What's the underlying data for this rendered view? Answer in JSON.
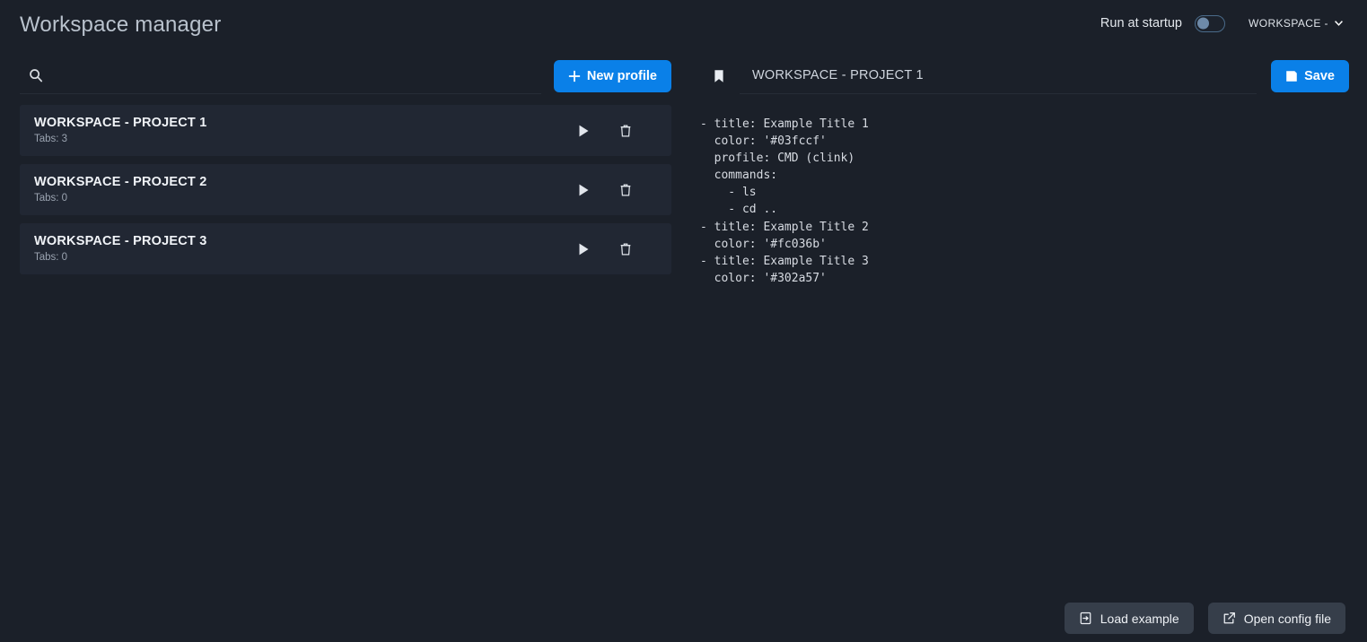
{
  "app": {
    "title": "Workspace manager",
    "accent_color": "#0a80e8",
    "background_color": "#1b2029",
    "row_color": "#212733"
  },
  "header": {
    "run_at_startup_label": "Run at startup",
    "run_at_startup_enabled": false,
    "workspace_select_value": "WORKSPACE - P",
    "workspace_select_icon": "chevron-down-icon"
  },
  "left": {
    "search": {
      "value": "",
      "placeholder": "",
      "icon": "search-icon"
    },
    "new_profile_button": {
      "label": "New profile",
      "icon": "plus-icon"
    },
    "profiles": [
      {
        "title": "WORKSPACE - PROJECT 1",
        "tabs_label": "Tabs: 3",
        "run_icon": "play-icon",
        "delete_icon": "trash-icon"
      },
      {
        "title": "WORKSPACE - PROJECT 2",
        "tabs_label": "Tabs: 0",
        "run_icon": "play-icon",
        "delete_icon": "trash-icon"
      },
      {
        "title": "WORKSPACE - PROJECT 3",
        "tabs_label": "Tabs: 0",
        "run_icon": "play-icon",
        "delete_icon": "trash-icon"
      }
    ]
  },
  "right": {
    "bookmark_icon": "bookmark-icon",
    "profile_name": {
      "value": "WORKSPACE - PROJECT 1",
      "placeholder": ""
    },
    "save_button": {
      "label": "Save",
      "icon": "save-icon"
    },
    "editor": {
      "content": "- title: Example Title 1\n  color: '#03fccf'\n  profile: CMD (clink)\n  commands:\n    - ls\n    - cd ..\n- title: Example Title 2\n  color: '#fc036b'\n- title: Example Title 3\n  color: '#302a57'"
    },
    "footer": {
      "load_example_button": {
        "label": "Load example",
        "icon": "file-import-icon"
      },
      "open_config_button": {
        "label": "Open config file",
        "icon": "external-link-icon"
      }
    }
  }
}
